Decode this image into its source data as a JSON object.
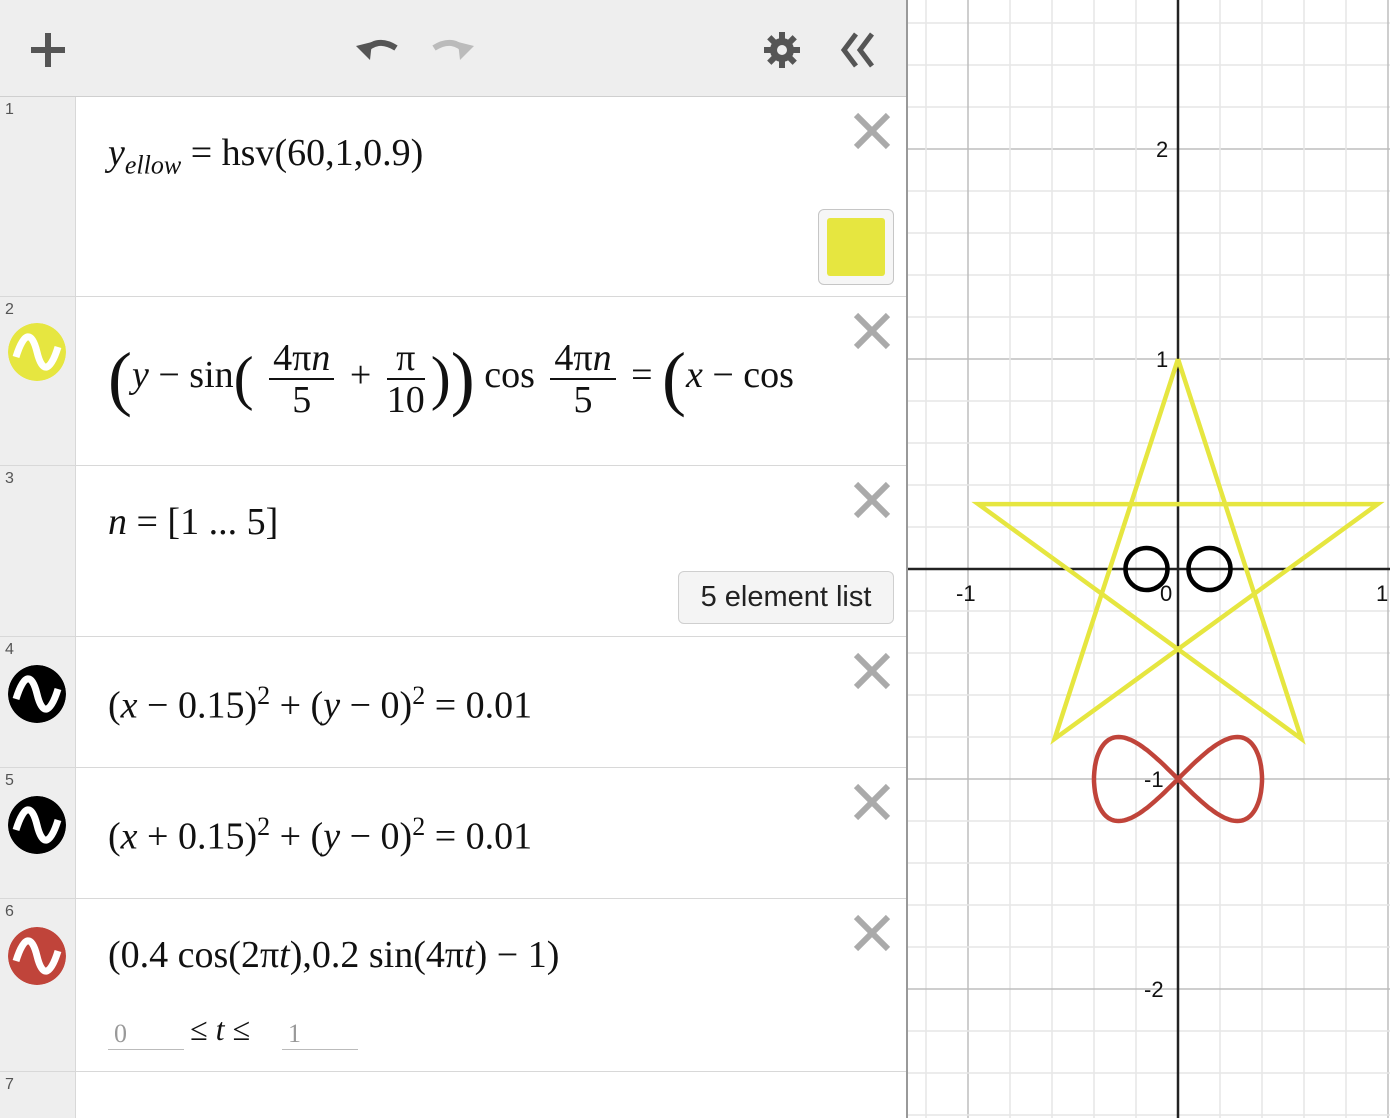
{
  "toolbar": {
    "add": "plus-icon",
    "undo": "undo-icon",
    "redo": "redo-icon",
    "settings": "gear-icon",
    "collapse": "double-chevron-left-icon"
  },
  "expressions": [
    {
      "num": "1",
      "text": "y_ellow = hsv(60,1,0.9)",
      "swatch_color": "#e6e640"
    },
    {
      "num": "2",
      "icon_color": "#e6e640"
    },
    {
      "num": "3",
      "list_badge": "5 element list"
    },
    {
      "num": "4",
      "icon_color": "#000000"
    },
    {
      "num": "5",
      "icon_color": "#000000"
    },
    {
      "num": "6",
      "icon_color": "#c0443a",
      "t_min": "0",
      "t_max": "1"
    },
    {
      "num": "7"
    }
  ],
  "graph": {
    "x_ticks": [
      "-1",
      "0",
      "1"
    ],
    "y_ticks": [
      "2",
      "1",
      "-1",
      "-2"
    ],
    "star_color": "#e6e640",
    "circle_color": "#000000",
    "lemniscate_color": "#c0443a"
  }
}
